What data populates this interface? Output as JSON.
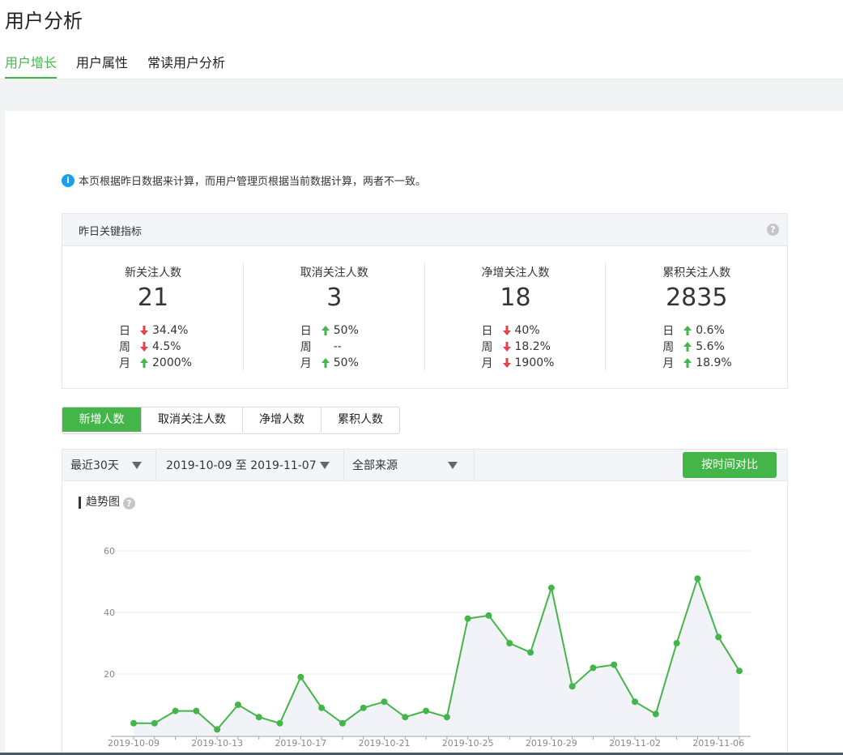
{
  "page": {
    "title": "用户分析"
  },
  "tabs": [
    {
      "label": "用户增长",
      "active": true
    },
    {
      "label": "用户属性",
      "active": false
    },
    {
      "label": "常读用户分析",
      "active": false
    }
  ],
  "notice": {
    "text": "本页根据昨日数据来计算，而用户管理页根据当前数据计算，两者不一致。"
  },
  "kpi": {
    "header": "昨日关键指标",
    "items": [
      {
        "label": "新关注人数",
        "value": "21",
        "rows": [
          {
            "period": "日",
            "dir": "down",
            "pct": "34.4%"
          },
          {
            "period": "周",
            "dir": "down",
            "pct": "4.5%"
          },
          {
            "period": "月",
            "dir": "up",
            "pct": "2000%"
          }
        ]
      },
      {
        "label": "取消关注人数",
        "value": "3",
        "rows": [
          {
            "period": "日",
            "dir": "up",
            "pct": "50%"
          },
          {
            "period": "周",
            "dir": "none",
            "pct": "--"
          },
          {
            "period": "月",
            "dir": "up",
            "pct": "50%"
          }
        ]
      },
      {
        "label": "净增关注人数",
        "value": "18",
        "rows": [
          {
            "period": "日",
            "dir": "down",
            "pct": "40%"
          },
          {
            "period": "周",
            "dir": "down",
            "pct": "18.2%"
          },
          {
            "period": "月",
            "dir": "down",
            "pct": "1900%"
          }
        ]
      },
      {
        "label": "累积关注人数",
        "value": "2835",
        "rows": [
          {
            "period": "日",
            "dir": "up",
            "pct": "0.6%"
          },
          {
            "period": "周",
            "dir": "up",
            "pct": "5.6%"
          },
          {
            "period": "月",
            "dir": "up",
            "pct": "18.9%"
          }
        ]
      }
    ]
  },
  "segments": [
    {
      "label": "新增人数",
      "active": true
    },
    {
      "label": "取消关注人数",
      "active": false
    },
    {
      "label": "净增人数",
      "active": false
    },
    {
      "label": "累积人数",
      "active": false
    }
  ],
  "filters": {
    "range": "最近30天",
    "dates": "2019-10-09 至 2019-11-07",
    "source": "全部来源",
    "compare": "按时间对比"
  },
  "trend": {
    "title": "趋势图"
  },
  "colors": {
    "accent": "#44b549",
    "up": "#44b549",
    "down": "#e5434c",
    "info": "#1aa0f0"
  },
  "chart_data": {
    "type": "area",
    "x": [
      "2019-10-09",
      "2019-10-10",
      "2019-10-11",
      "2019-10-12",
      "2019-10-13",
      "2019-10-14",
      "2019-10-15",
      "2019-10-16",
      "2019-10-17",
      "2019-10-18",
      "2019-10-19",
      "2019-10-20",
      "2019-10-21",
      "2019-10-22",
      "2019-10-23",
      "2019-10-24",
      "2019-10-25",
      "2019-10-26",
      "2019-10-27",
      "2019-10-28",
      "2019-10-29",
      "2019-10-30",
      "2019-10-31",
      "2019-11-01",
      "2019-11-02",
      "2019-11-03",
      "2019-11-04",
      "2019-11-05",
      "2019-11-06",
      "2019-11-07"
    ],
    "y": [
      4,
      4,
      8,
      8,
      2,
      10,
      6,
      4,
      19,
      9,
      4,
      9,
      11,
      6,
      8,
      6,
      38,
      39,
      30,
      27,
      48,
      16,
      22,
      23,
      11,
      7,
      30,
      51,
      32,
      21
    ],
    "tick_labels": [
      "2019-10-09",
      "2019-10-13",
      "2019-10-17",
      "2019-10-21",
      "2019-10-25",
      "2019-10-29",
      "2019-11-02",
      "2019-11-06"
    ],
    "yticks": [
      20,
      40,
      60
    ],
    "ylim": [
      0,
      60
    ],
    "grid": true
  }
}
